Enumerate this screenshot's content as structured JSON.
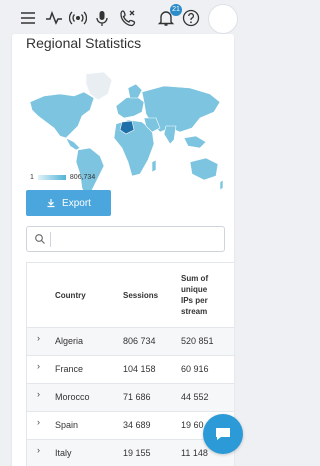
{
  "topbar": {
    "icons": [
      "menu-icon",
      "activity-icon",
      "broadcast-icon",
      "microphone-icon",
      "missed-call-icon",
      "notification-bell-icon",
      "help-icon"
    ],
    "notification_count": "21"
  },
  "card": {
    "title": "Regional Statistics"
  },
  "legend": {
    "min": "1",
    "max": "806,734"
  },
  "export_label": "Export",
  "search": {
    "placeholder": ""
  },
  "table": {
    "headers": {
      "country": "Country",
      "sessions": "Sessions",
      "sum_ips": "Sum of unique IPs per stream"
    },
    "rows": [
      {
        "country": "Algeria",
        "sessions": "806 734",
        "ips": "520 851"
      },
      {
        "country": "France",
        "sessions": "104 158",
        "ips": "60 916"
      },
      {
        "country": "Morocco",
        "sessions": "71 686",
        "ips": "44 552"
      },
      {
        "country": "Spain",
        "sessions": "34 689",
        "ips": "19 60"
      },
      {
        "country": "Italy",
        "sessions": "19 155",
        "ips": "11 148"
      }
    ]
  },
  "colors": {
    "accent": "#4aa6dc",
    "map_water_land": "#7cc4df",
    "map_highlight": "#1f6fa8"
  }
}
